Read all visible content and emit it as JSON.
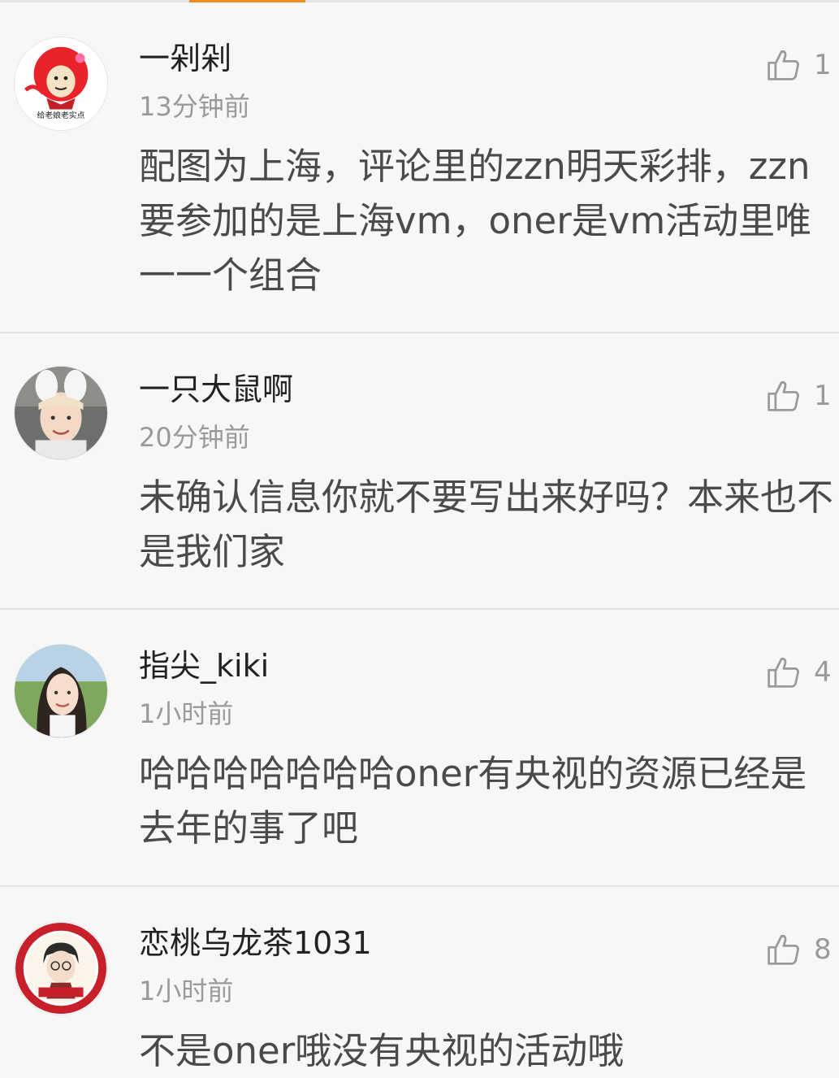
{
  "comments": [
    {
      "username": "一剁剁",
      "time": "13分钟前",
      "likes": "1",
      "content": "配图为上海，评论里的zzn明天彩排，zzn要参加的是上海vm，oner是vm活动里唯一一个组合",
      "avatar_caption": "给老娘老实点"
    },
    {
      "username": "一只大鼠啊",
      "time": "20分钟前",
      "likes": "1",
      "content": "未确认信息你就不要写出来好吗？本来也不是我们家"
    },
    {
      "username": "指尖_kiki",
      "time": "1小时前",
      "likes": "4",
      "content": "哈哈哈哈哈哈哈oner有央视的资源已经是去年的事了吧"
    },
    {
      "username": "恋桃乌龙茶1031",
      "time": "1小时前",
      "likes": "8",
      "content": "不是oner哦没有央视的活动哦"
    }
  ],
  "icons": {
    "like": "thumbs-up-icon"
  },
  "colors": {
    "accent": "#f08a24",
    "background": "#f7f7f7",
    "divider": "#e3e3e3",
    "username": "#222222",
    "meta": "#9a9a9a",
    "content": "#4a4a4a"
  }
}
